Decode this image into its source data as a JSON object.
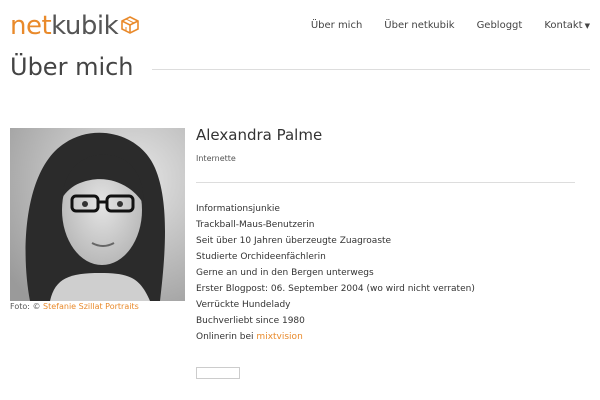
{
  "logo": {
    "net": "net",
    "kubik": "kubik"
  },
  "nav": {
    "items": [
      {
        "label": "Über mich"
      },
      {
        "label": "Über netkubik"
      },
      {
        "label": "Gebloggt"
      },
      {
        "label": "Kontakt"
      }
    ]
  },
  "page": {
    "title": "Über mich"
  },
  "photo": {
    "caption_prefix": "Foto: ©",
    "caption_link": "Stefanie Szillat Portraits"
  },
  "profile": {
    "name": "Alexandra Palme",
    "role": "Internette",
    "facts": [
      "Informationsjunkie",
      "Trackball-Maus-Benutzerin",
      "Seit über 10 Jahren überzeugte Zuagroaste",
      "Studierte Orchideenfächlerin",
      "Gerne an und in den Bergen unterwegs",
      "Erster Blogpost: 06. September 2004 (wo wird nicht verraten)",
      "Verrückte Hundelady",
      "Buchverliebt since 1980"
    ],
    "last_fact_prefix": "Onlinerin bei",
    "last_fact_link": "mixtvision"
  },
  "colors": {
    "accent": "#e98a2b",
    "text": "#333333",
    "rule": "#dddddd"
  }
}
